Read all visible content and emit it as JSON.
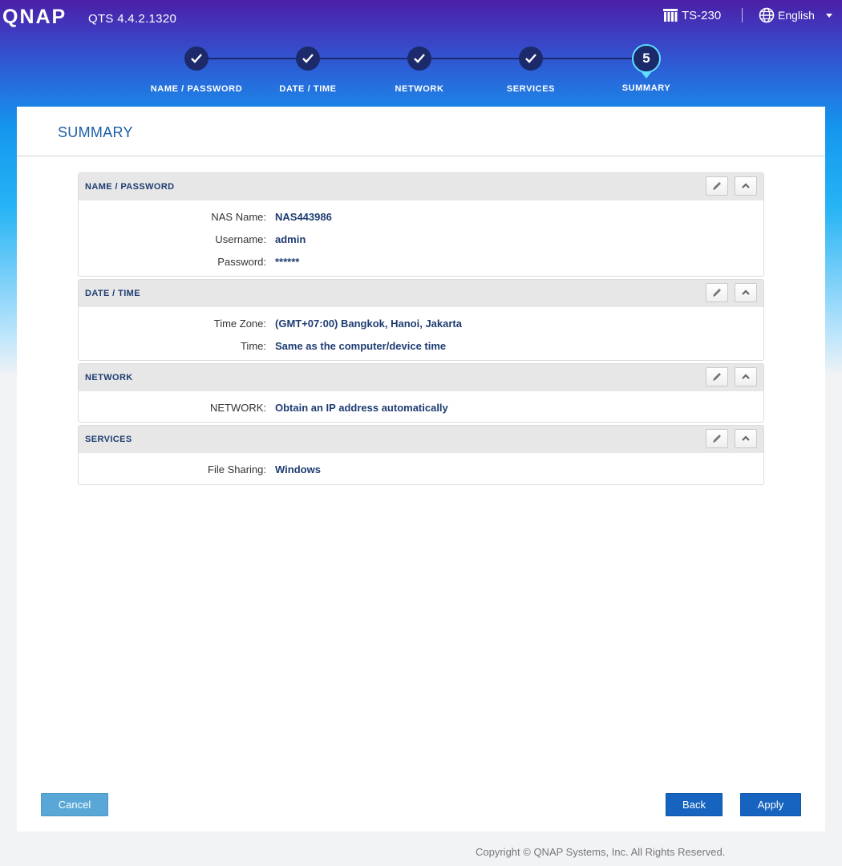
{
  "app": {
    "logo_text": "QNAP",
    "version": "QTS 4.4.2.1320",
    "device": "TS-230",
    "language": "English"
  },
  "stepper": {
    "steps": [
      {
        "label": "NAME / PASSWORD",
        "state": "done"
      },
      {
        "label": "DATE / TIME",
        "state": "done"
      },
      {
        "label": "NETWORK",
        "state": "done"
      },
      {
        "label": "SERVICES",
        "state": "done"
      },
      {
        "label": "SUMMARY",
        "state": "active",
        "number": "5"
      }
    ]
  },
  "panel": {
    "title": "SUMMARY"
  },
  "sections": {
    "name_password": {
      "title": "NAME / PASSWORD",
      "rows": [
        {
          "key": "NAS Name:",
          "value": "NAS443986"
        },
        {
          "key": "Username:",
          "value": "admin"
        },
        {
          "key": "Password:",
          "value": "******"
        }
      ]
    },
    "date_time": {
      "title": "DATE / TIME",
      "rows": [
        {
          "key": "Time Zone:",
          "value": "(GMT+07:00) Bangkok, Hanoi, Jakarta"
        },
        {
          "key": "Time:",
          "value": "Same as the computer/device time"
        }
      ]
    },
    "network": {
      "title": "NETWORK",
      "rows": [
        {
          "key": "NETWORK:",
          "value": "Obtain an IP address automatically"
        }
      ]
    },
    "services": {
      "title": "SERVICES",
      "rows": [
        {
          "key": "File Sharing:",
          "value": "Windows"
        }
      ]
    }
  },
  "buttons": {
    "cancel": "Cancel",
    "back": "Back",
    "apply": "Apply"
  },
  "footer": {
    "copyright": "Copyright © QNAP Systems, Inc. All Rights Reserved."
  },
  "colors": {
    "accent": "#1664c0",
    "title_blue": "#1b5ea8",
    "value_navy": "#1e3c72",
    "step_dark": "#1c2a6b",
    "step_active_ring": "#5fe0ff"
  },
  "icons": {
    "device": "nas-device-icon",
    "language": "globe-icon",
    "edit": "pencil-icon",
    "collapse": "chevron-up-icon",
    "done": "check-icon"
  }
}
